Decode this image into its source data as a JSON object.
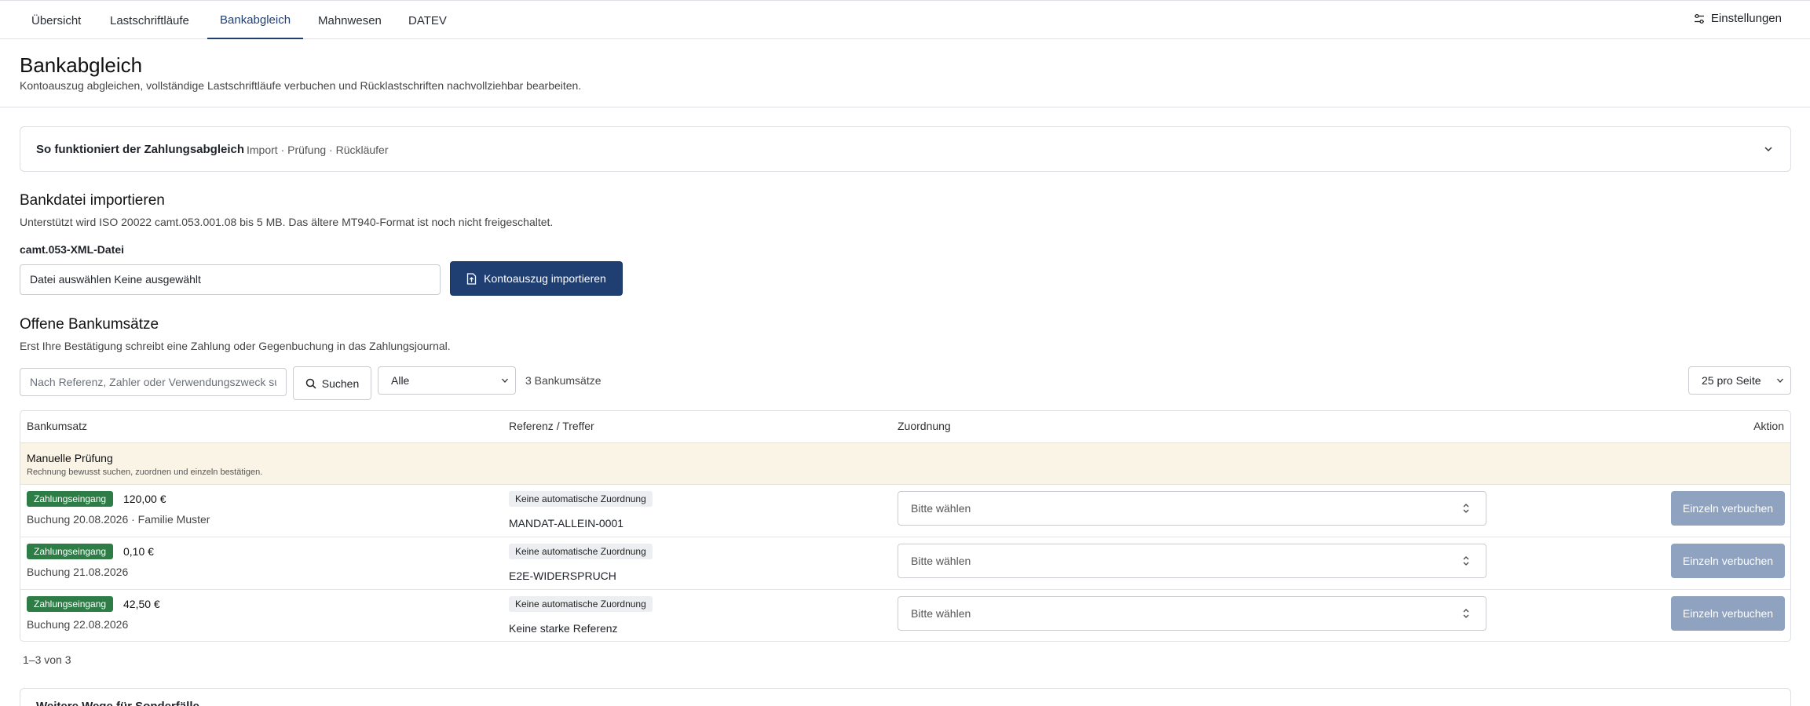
{
  "nav": {
    "tabs": [
      {
        "label": "Übersicht"
      },
      {
        "label": "Lastschriftläufe"
      },
      {
        "label": "Bankabgleich"
      },
      {
        "label": "Mahnwesen"
      },
      {
        "label": "DATEV"
      }
    ],
    "active_tab": "Bankabgleich",
    "settings_label": "Einstellungen"
  },
  "header": {
    "title": "Bankabgleich",
    "subtitle": "Kontoauszug abgleichen, vollständige Lastschriftläufe verbuchen und Rücklastschriften nachvollziehbar bearbeiten."
  },
  "info_accordion": {
    "title": "So funktioniert der Zahlungsabgleich",
    "subtitle": "Import · Prüfung · Rückläufer",
    "expanded": false
  },
  "import": {
    "title": "Bankdatei importieren",
    "description": "Unterstützt wird ISO 20022 camt.053.001.08 bis 5 MB. Das ältere MT940-Format ist noch nicht freigeschaltet.",
    "field_label": "camt.053-XML-Datei",
    "file_value": "Datei auswählen Keine ausgewählt",
    "button_label": "Kontoauszug importieren"
  },
  "open_transactions": {
    "title": "Offene Bankumsätze",
    "description": "Erst Ihre Bestätigung schreibt eine Zahlung oder Gegenbuchung in das Zahlungsjournal.",
    "search_placeholder": "Nach Referenz, Zahler oder Verwendungszweck suchen",
    "search_button": "Suchen",
    "filter_value": "Alle",
    "count_text": "3 Bankumsätze",
    "page_size": "25 pro Seite",
    "columns": {
      "transaction": "Bankumsatz",
      "reference": "Referenz / Treffer",
      "assignment": "Zuordnung",
      "action": "Aktion"
    },
    "group": {
      "title": "Manuelle Prüfung",
      "subtitle": "Rechnung bewusst suchen, zuordnen und einzeln bestätigen."
    },
    "rows": [
      {
        "type": "Zahlungseingang",
        "amount": "120,00 €",
        "booking": "Buchung 20.08.2026 · Familie Muster",
        "match_status": "Keine automatische Zuordnung",
        "reference": "MANDAT-ALLEIN-0001",
        "assignment": "Bitte wählen",
        "action": "Einzeln verbuchen"
      },
      {
        "type": "Zahlungseingang",
        "amount": "0,10 €",
        "booking": "Buchung 21.08.2026",
        "match_status": "Keine automatische Zuordnung",
        "reference": "E2E-WIDERSPRUCH",
        "assignment": "Bitte wählen",
        "action": "Einzeln verbuchen"
      },
      {
        "type": "Zahlungseingang",
        "amount": "42,50 €",
        "booking": "Buchung 22.08.2026",
        "match_status": "Keine automatische Zuordnung",
        "reference": "Keine starke Referenz",
        "assignment": "Bitte wählen",
        "action": "Einzeln verbuchen"
      }
    ],
    "pagination": "1–3 von 3"
  },
  "next_section": {
    "title": "Weitere Wege für Sonderfälle"
  },
  "colors": {
    "primary": "#1f3f73",
    "success_badge": "#2e7d47",
    "disabled_button": "#8fa2bf",
    "group_background": "#faf4e6"
  },
  "icons": {
    "settings": "sliders-icon",
    "accordion": "chevron-down-icon",
    "import": "file-upload-icon",
    "search": "search-icon",
    "select": "chevron-down-icon",
    "assignment": "up-down-chevron-icon"
  }
}
